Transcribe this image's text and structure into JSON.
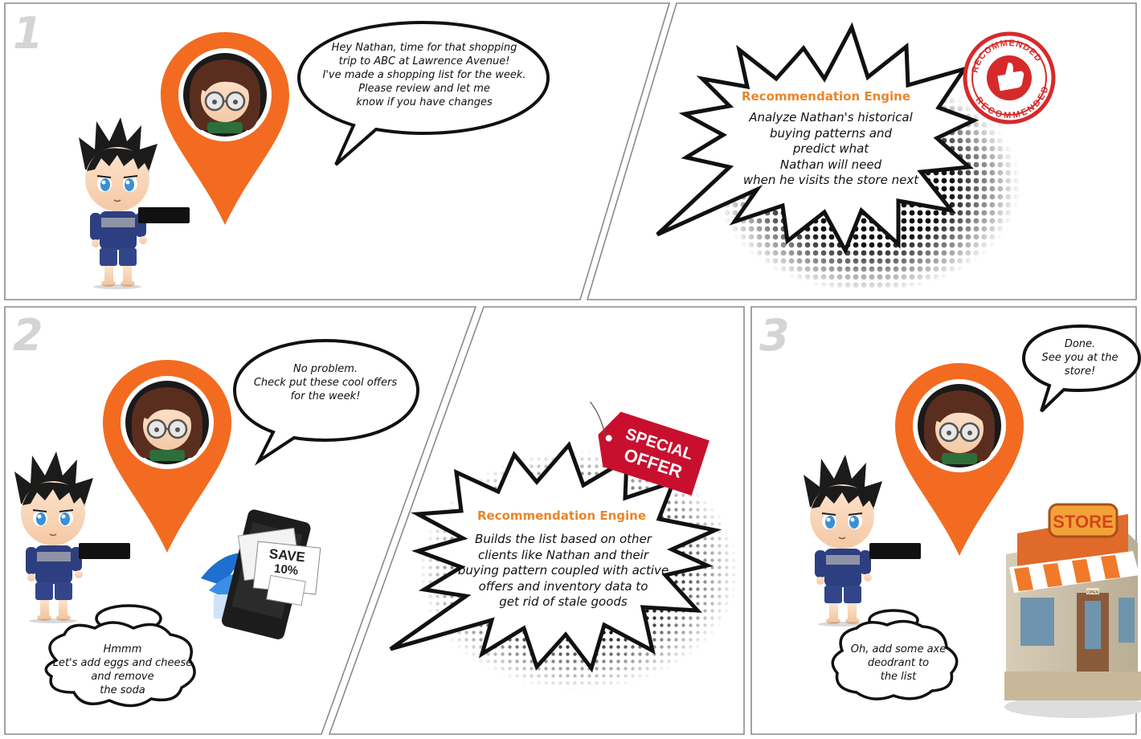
{
  "panel_numbers": [
    "1",
    "2",
    "3"
  ],
  "panel1": {
    "assistant_bubble": [
      "Hey Nathan, time for that shopping",
      "trip to ABC at Lawrence Avenue!",
      "I've made a shopping list for the week.",
      "Please review and let me",
      "know if you have changes"
    ]
  },
  "panel1b": {
    "engine_title": "Recommendation Engine",
    "engine_body": [
      "Analyze Nathan's historical",
      "buying patterns and",
      "predict what",
      "Nathan will need",
      "when he visits the store next"
    ],
    "stamp_text": "RECOMMENDED"
  },
  "panel2": {
    "assistant_bubble": [
      "No problem.",
      "Check put these cool offers",
      "for the week!"
    ],
    "thought_bubble": [
      "Hmmm",
      "Let's add eggs and cheese",
      "and remove",
      "the soda"
    ],
    "phone_ad": [
      "SAVE",
      "10%"
    ]
  },
  "panel2b": {
    "engine_title": "Recommendation Engine",
    "engine_body": [
      "Builds the list based on other",
      "clients like Nathan and their",
      "buying pattern coupled with active",
      "offers and inventory data to",
      "get rid of stale goods"
    ],
    "tag_text": [
      "SPECIAL",
      "OFFER"
    ]
  },
  "panel3": {
    "assistant_bubble": [
      "Done.",
      "See you at the",
      "store!"
    ],
    "thought_bubble": [
      "Oh, add some axe",
      "deodrant to",
      "the list"
    ],
    "store_sign": "STORE",
    "door_sign": "OPEN"
  },
  "colors": {
    "pin_orange": "#f26b21",
    "engine_title_orange": "#e8862a",
    "stamp_red": "#d62a2a",
    "tag_red": "#c8102e",
    "panel_number_gray": "#d4d4d4",
    "border_gray": "#8a8a8a"
  },
  "icons": [
    "map-pin-icon",
    "thumbs-up-icon",
    "smartphone-icon",
    "store-icon",
    "coupon-icon"
  ]
}
